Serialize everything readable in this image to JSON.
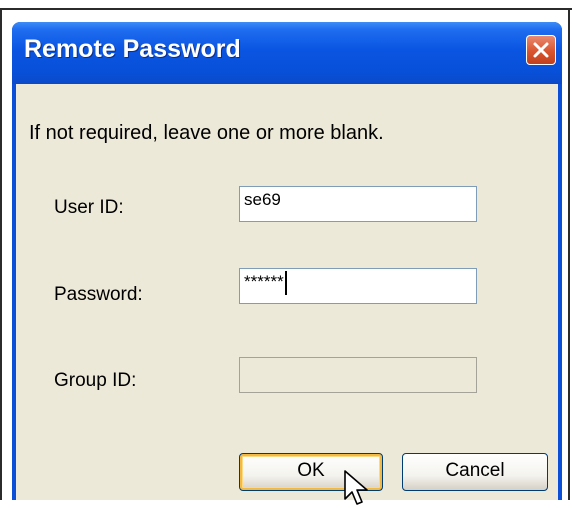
{
  "window": {
    "title": "Remote Password",
    "close_icon": "close-icon"
  },
  "dialog": {
    "instruction": "If not required, leave one or more blank.",
    "fields": {
      "user_id": {
        "label": "User ID:",
        "value": "se69"
      },
      "password": {
        "label": "Password:",
        "value": "******"
      },
      "group_id": {
        "label": "Group ID:",
        "value": ""
      }
    },
    "buttons": {
      "ok": "OK",
      "cancel": "Cancel"
    }
  },
  "colors": {
    "titlebar": "#0a55e2",
    "dialog_background": "#ece9d8",
    "close_button": "#d8552f",
    "default_button_focus": "#f6b940"
  },
  "pointer_icon": "arrow-cursor-icon"
}
